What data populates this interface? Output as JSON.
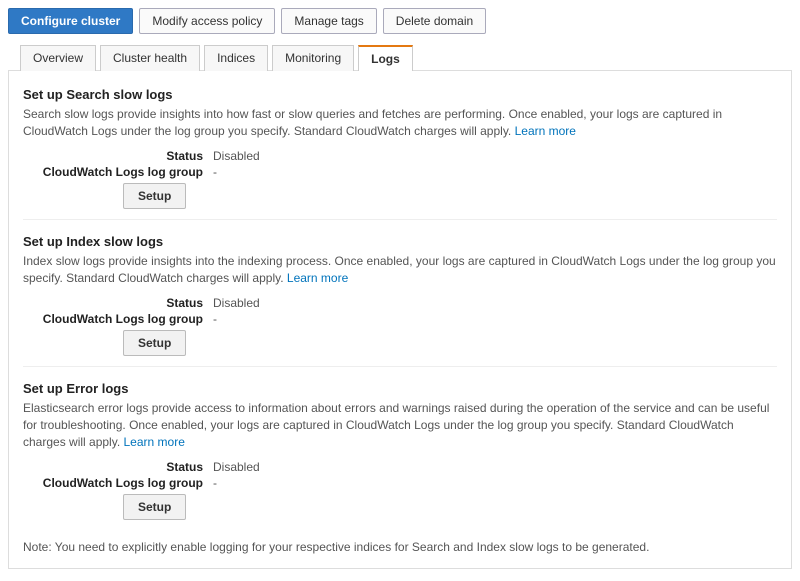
{
  "toolbar": {
    "configure": "Configure cluster",
    "modify_policy": "Modify access policy",
    "manage_tags": "Manage tags",
    "delete_domain": "Delete domain"
  },
  "tabs": {
    "overview": "Overview",
    "cluster_health": "Cluster health",
    "indices": "Indices",
    "monitoring": "Monitoring",
    "logs": "Logs"
  },
  "labels": {
    "status": "Status",
    "log_group": "CloudWatch Logs log group",
    "setup": "Setup",
    "learn_more": "Learn more"
  },
  "sections": {
    "search": {
      "title": "Set up Search slow logs",
      "desc": "Search slow logs provide insights into how fast or slow queries and fetches are performing. Once enabled, your logs are captured in CloudWatch Logs under the log group you specify. Standard CloudWatch charges will apply. ",
      "status": "Disabled",
      "log_group": "-"
    },
    "index": {
      "title": "Set up Index slow logs",
      "desc": "Index slow logs provide insights into the indexing process. Once enabled, your logs are captured in CloudWatch Logs under the log group you specify. Standard CloudWatch charges will apply. ",
      "status": "Disabled",
      "log_group": "-"
    },
    "error": {
      "title": "Set up Error logs",
      "desc": "Elasticsearch error logs provide access to information about errors and warnings raised during the operation of the service and can be useful for troubleshooting. Once enabled, your logs are captured in CloudWatch Logs under the log group you specify. Standard CloudWatch charges will apply. ",
      "status": "Disabled",
      "log_group": "-"
    }
  },
  "footnote": "Note: You need to explicitly enable logging for your respective indices for Search and Index slow logs to be generated."
}
